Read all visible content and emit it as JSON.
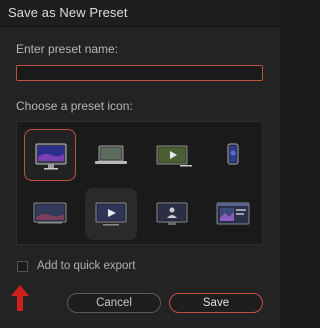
{
  "dialog": {
    "title": "Save as New Preset",
    "name_label": "Enter preset name:",
    "name_value": "",
    "icon_label": "Choose a preset icon:",
    "icons": [
      {
        "name": "imac-icon",
        "selected": true
      },
      {
        "name": "laptop-icon",
        "selected": false
      },
      {
        "name": "tablet-play-icon",
        "selected": false
      },
      {
        "name": "smartphone-icon",
        "selected": false
      },
      {
        "name": "monitor-landscape-icon",
        "selected": false
      },
      {
        "name": "tv-play-icon",
        "selected": false
      },
      {
        "name": "screen-person-icon",
        "selected": false
      },
      {
        "name": "window-gallery-icon",
        "selected": false
      }
    ],
    "quick_export_label": "Add to quick export",
    "quick_export_checked": false,
    "cancel_label": "Cancel",
    "save_label": "Save"
  },
  "colors": {
    "accent": "#c0503f",
    "background": "#232323",
    "annotation_arrow": "#d01e1e"
  }
}
